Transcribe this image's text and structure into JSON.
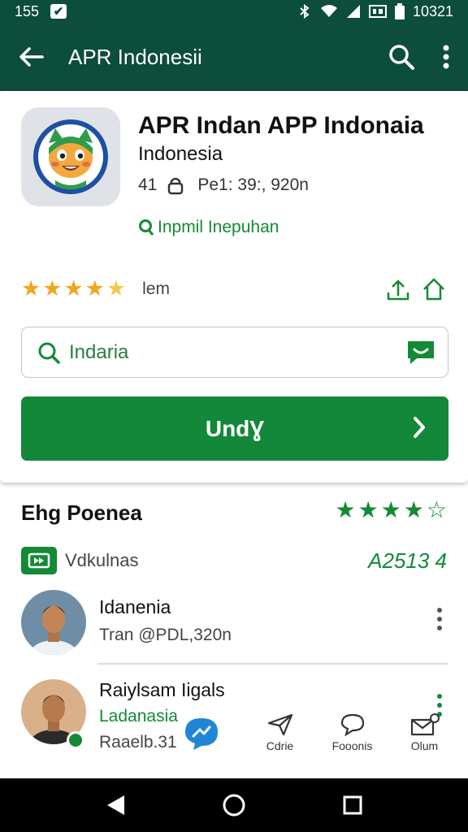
{
  "status_bar": {
    "time": "155",
    "clock": "10321"
  },
  "app_bar": {
    "title": "APR Indonesii"
  },
  "app": {
    "title": "APR Indan APP Indonaia",
    "subtitle": "Indonesia",
    "meta_count": "41",
    "meta_text": "Pe1: 39:, 920n",
    "tag": "Inpmil  Inepuhan"
  },
  "rating": {
    "stars": 4.5,
    "label": "lem"
  },
  "search": {
    "text": "Indaria"
  },
  "install": {
    "label": "UndƔ"
  },
  "section": {
    "title": "Ehg Poenea",
    "stars": 4
  },
  "video_row": {
    "label": "Vdkulnas",
    "count": "A2513 4"
  },
  "reviews": [
    {
      "name": "Idanenia",
      "date": "Tran @PDL,320n"
    },
    {
      "name": "Raiylsam Iigals",
      "location": "Ladanasia",
      "date": "Raaelb.31"
    }
  ],
  "tools": [
    {
      "label": "Cdrie"
    },
    {
      "label": "Fooonis"
    },
    {
      "label": "Olum"
    }
  ],
  "colors": {
    "primary": "#0d4d3b",
    "accent": "#13883a",
    "star": "#f3a51c"
  }
}
